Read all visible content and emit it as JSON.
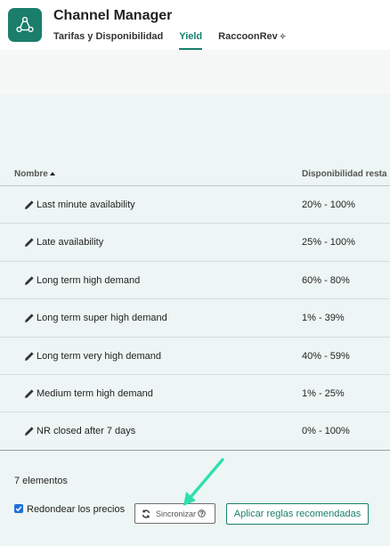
{
  "app": {
    "title": "Channel Manager",
    "logo_icon": "share-nodes-icon"
  },
  "tabs": [
    {
      "label": "Tarifas y Disponibilidad",
      "active": false
    },
    {
      "label": "Yield",
      "active": true
    },
    {
      "label": "RaccoonRev",
      "active": false,
      "pinned": true
    }
  ],
  "table": {
    "columns": {
      "name": "Nombre",
      "availability": "Disponibilidad resta"
    },
    "rows": [
      {
        "name": "Last minute availability",
        "range": "20% - 100%"
      },
      {
        "name": "Late availability",
        "range": "25% - 100%"
      },
      {
        "name": "Long term high demand",
        "range": "60% - 80%"
      },
      {
        "name": "Long term super high demand",
        "range": "1% - 39%"
      },
      {
        "name": "Long term very high demand",
        "range": "40% - 59%"
      },
      {
        "name": "Medium term high demand",
        "range": "1% - 25%"
      },
      {
        "name": "NR closed after 7 days",
        "range": "0% - 100%"
      }
    ]
  },
  "footer": {
    "count": "7 elementos",
    "round_prices": {
      "label": "Redondear los precios",
      "checked": true
    },
    "sync_label": "Sincronizar",
    "apply_label": "Aplicar reglas recomendadas"
  },
  "colors": {
    "brand": "#1a7e6b",
    "active_tab": "#16806c",
    "content_bg": "#edf6f4",
    "annotation_arrow": "#2ee0b0"
  }
}
